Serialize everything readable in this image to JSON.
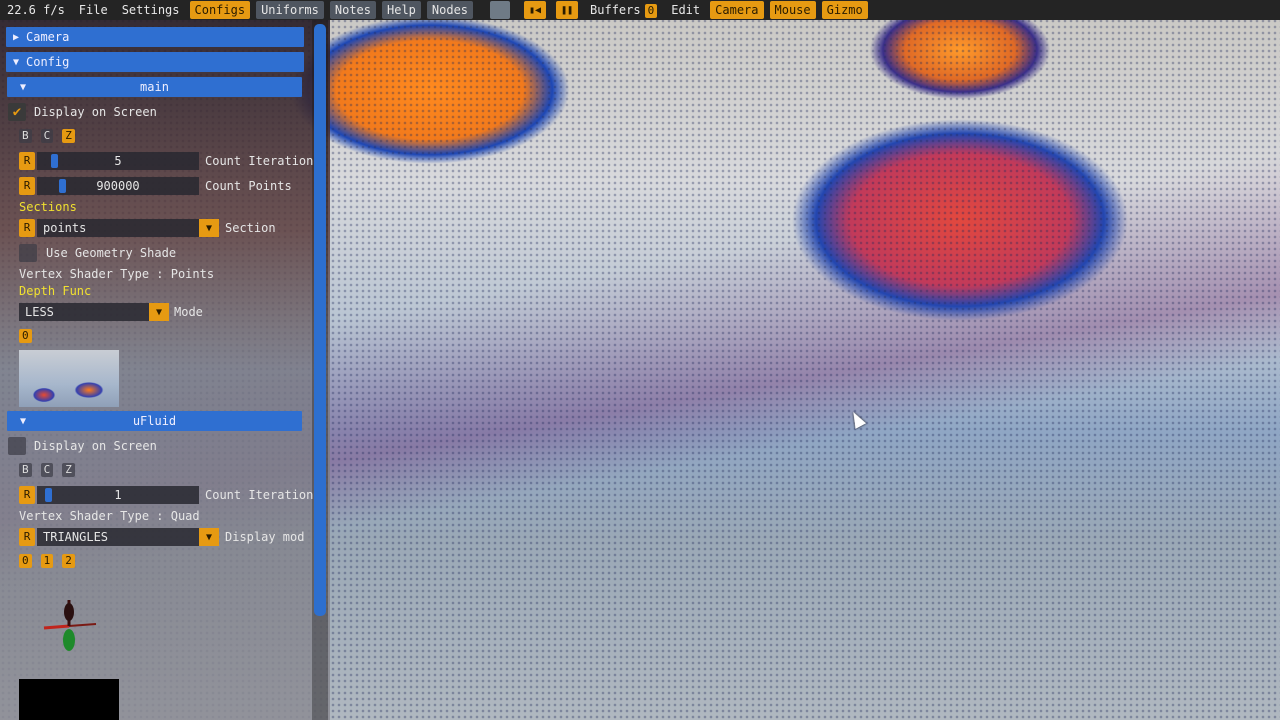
{
  "menubar": {
    "fps": "22.6 f/s",
    "file": "File",
    "settings": "Settings",
    "configs": "Configs",
    "uniforms": "Uniforms",
    "notes": "Notes",
    "help": "Help",
    "nodes": "Nodes",
    "buffers": "Buffers",
    "buffers_count": "0",
    "edit": "Edit",
    "camera": "Camera",
    "mouse": "Mouse",
    "gizmo": "Gizmo"
  },
  "panel": {
    "camera_header": "Camera",
    "config_header": "Config",
    "main": {
      "header": "main",
      "display_on_screen": "Display on Screen",
      "display_checked": true,
      "b": "B",
      "c": "C",
      "z": "Z",
      "r": "R",
      "count_iteration_value": "5",
      "count_iteration_label": "Count Iteration",
      "count_points_value": "900000",
      "count_points_label": "Count Points",
      "sections_label": "Sections",
      "section_value": "points",
      "section_label": "Section",
      "use_geometry_shader": "Use Geometry Shade",
      "vertex_shader_type": "Vertex Shader Type : Points",
      "depth_func_label": "Depth Func",
      "depth_mode_value": "LESS",
      "depth_mode_label": "Mode",
      "zero": "0"
    },
    "ufluid": {
      "header": "uFluid",
      "display_on_screen": "Display on Screen",
      "b": "B",
      "c": "C",
      "z": "Z",
      "r": "R",
      "count_iteration_value": "1",
      "count_iteration_label": "Count Iteration",
      "vertex_shader_type": "Vertex Shader Type : Quad",
      "display_mode_value": "TRIANGLES",
      "display_mode_label": "Display mod",
      "b0": "0",
      "b1": "1",
      "b2": "2"
    }
  },
  "colors": {
    "accent": "#e69a12",
    "header": "#2f6fd1",
    "menubar": "#242424"
  }
}
